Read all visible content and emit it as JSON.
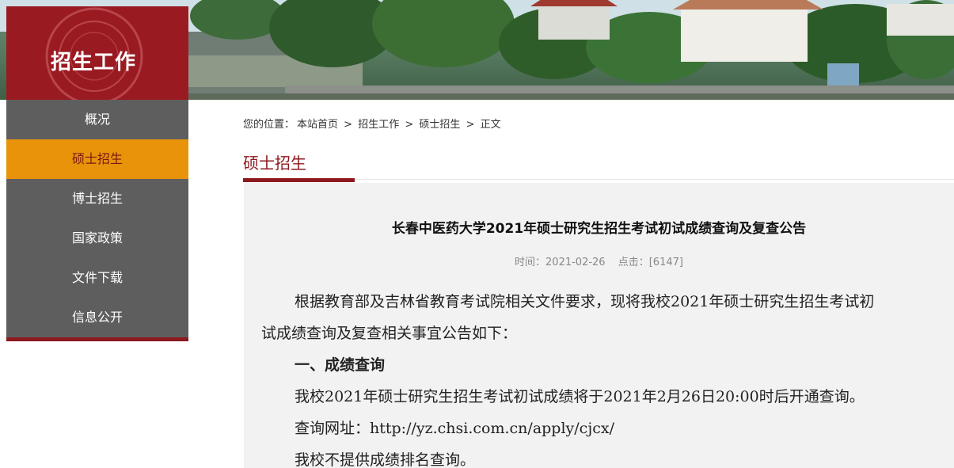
{
  "header": {
    "logo_title": "招生工作"
  },
  "sidebar": {
    "items": [
      {
        "label": "概况"
      },
      {
        "label": "硕士招生"
      },
      {
        "label": "博士招生"
      },
      {
        "label": "国家政策"
      },
      {
        "label": "文件下载"
      },
      {
        "label": "信息公开"
      }
    ],
    "active_index": 1
  },
  "breadcrumb": {
    "prefix": "您的位置：",
    "items": [
      "本站首页",
      "招生工作",
      "硕士招生",
      "正文"
    ],
    "separator": ">"
  },
  "section": {
    "title": "硕士招生"
  },
  "article": {
    "title": "长春中医药大学2021年硕士研究生招生考试初试成绩查询及复查公告",
    "time_label": "时间：2021-02-26",
    "hits_label": "点击：[6147]",
    "paragraph1_line1": "根据教育部及吉林省教育考试院相关文件要求，现将我校2021年硕士研究生招生考试初",
    "paragraph1_line2": "试成绩查询及复查相关事宜公告如下：",
    "heading1": "一、成绩查询",
    "paragraph2": "我校2021年硕士研究生招生考试初试成绩将于2021年2月26日20:00时后开通查询。",
    "paragraph3": "查询网址：http://yz.chsi.com.cn/apply/cjcx/",
    "paragraph4": "我校不提供成绩排名查询。"
  },
  "colors": {
    "brand_red": "#8c1a1f",
    "active_orange": "#e8930a",
    "sidebar_gray": "#5e5e5e"
  }
}
